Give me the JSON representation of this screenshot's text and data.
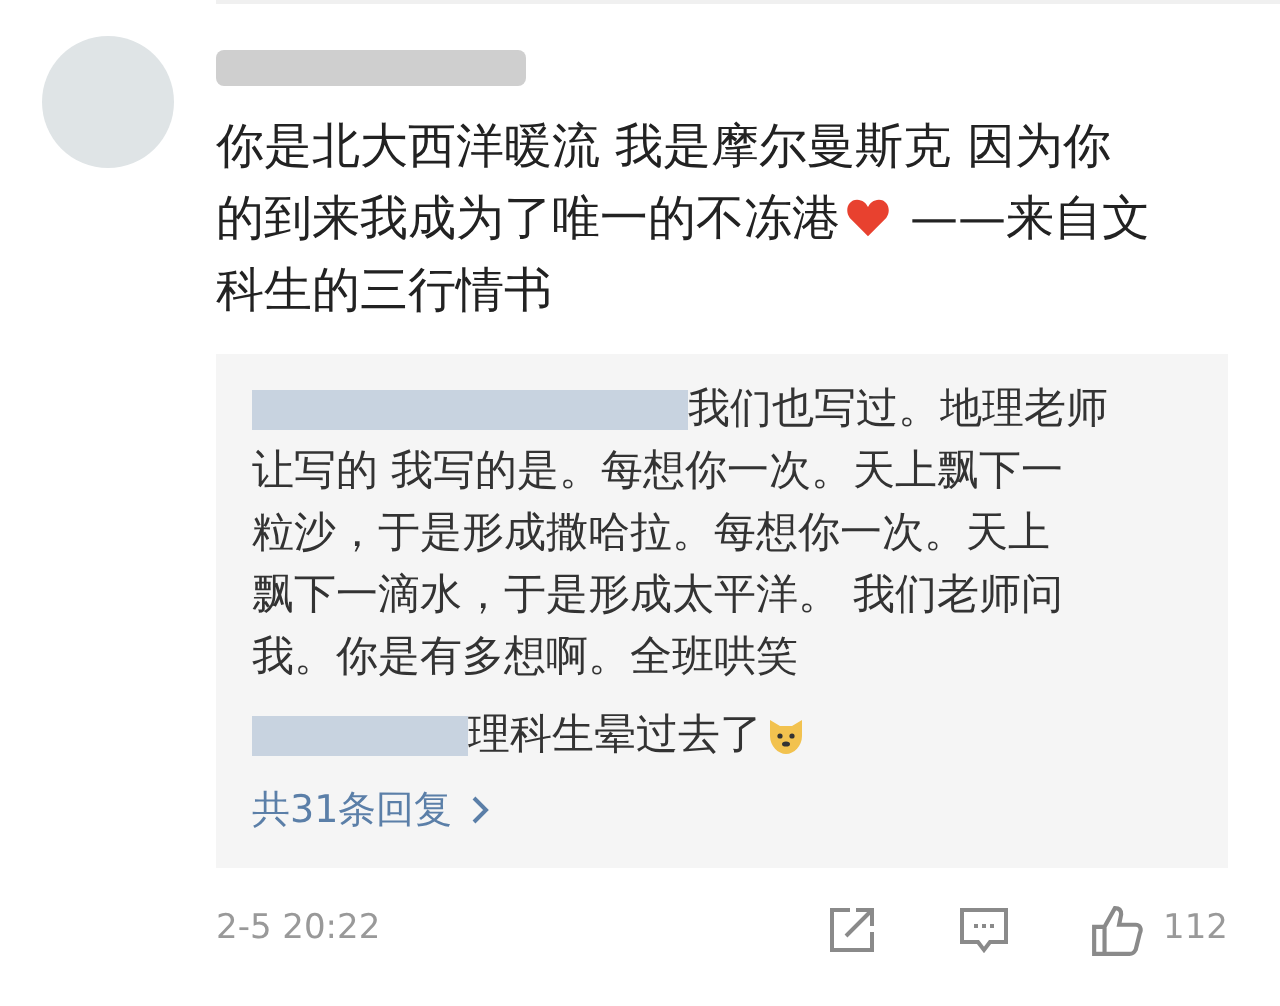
{
  "comment": {
    "lines": [
      [
        "你是北大西洋暖流 我是摩尔曼斯克 因为你"
      ],
      [
        "的到来我成为了唯一的不冻港",
        "——来自文"
      ],
      [
        "科生的三行情书"
      ]
    ],
    "replies": [
      {
        "lines": [
          "我们也写过。地理老师",
          "让写的  我写的是。每想你一次。天上飘下一",
          "粒沙，于是形成撒哈拉。每想你一次。天上",
          "飘下一滴水，于是形成太平洋。 我们老师问",
          "我。你是有多想啊。全班哄笑"
        ]
      },
      {
        "lines": [
          "理科生晕过去了"
        ]
      }
    ],
    "more_replies": "共31条回复",
    "timestamp": "2-5 20:22",
    "like_count": "112"
  }
}
